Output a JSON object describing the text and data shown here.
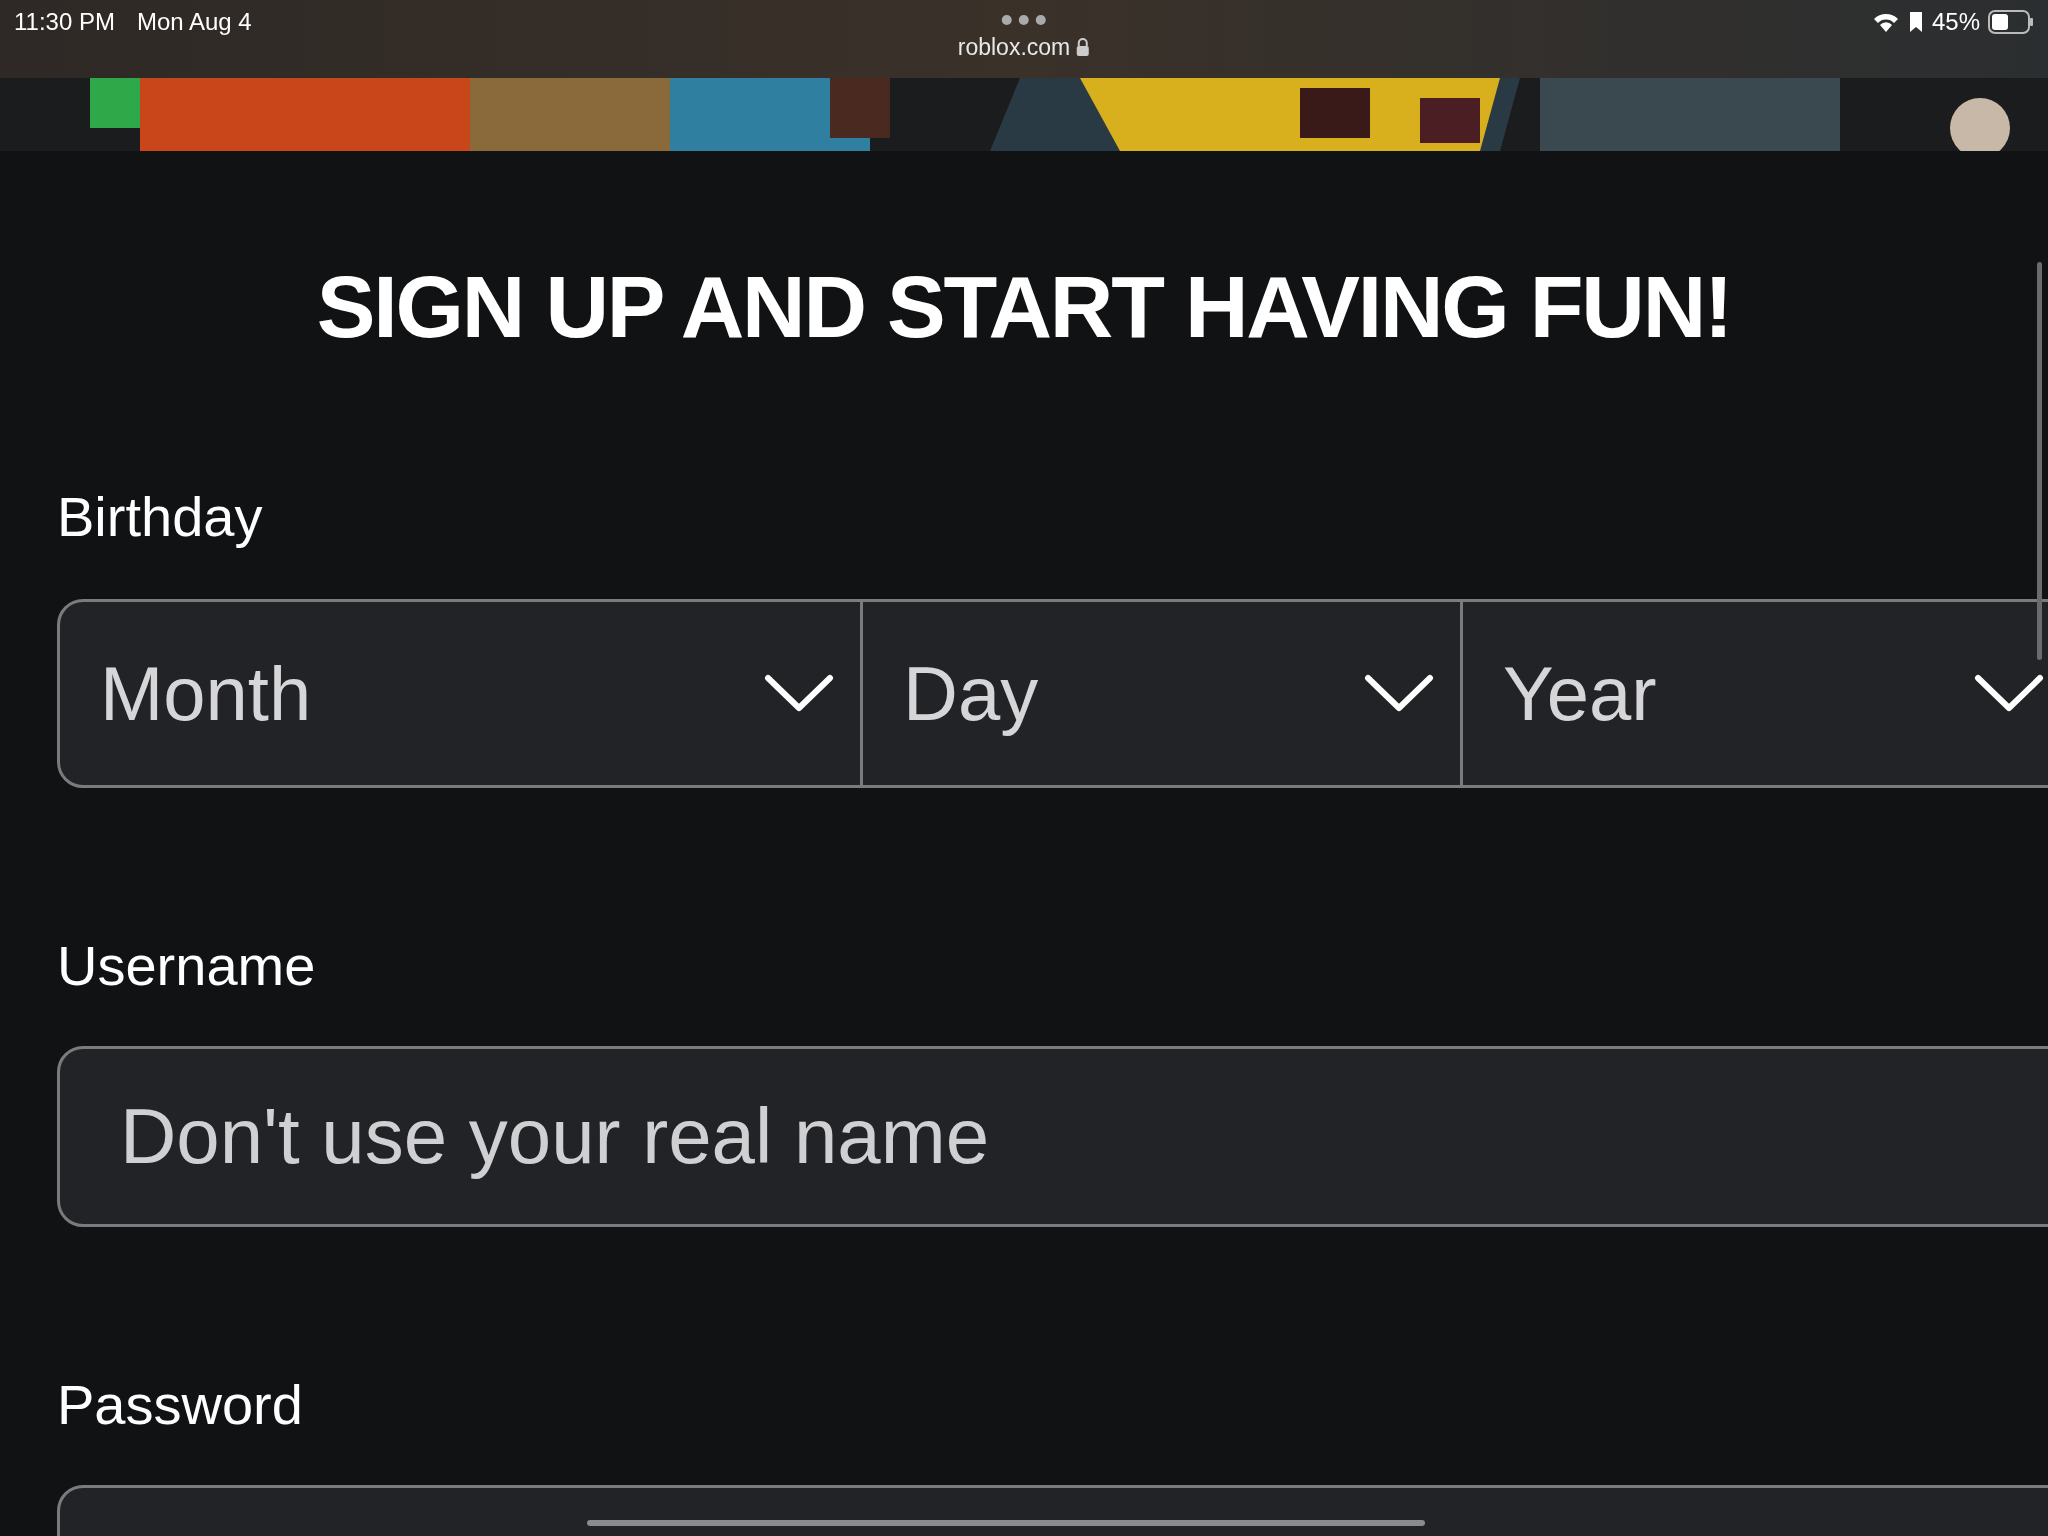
{
  "status_bar": {
    "time": "11:30 PM",
    "date": "Mon Aug 4",
    "url": "roblox.com",
    "battery": "45%"
  },
  "title": "SIGN UP AND START HAVING FUN!",
  "birthday": {
    "label": "Birthday",
    "selects": [
      {
        "label": "Month"
      },
      {
        "label": "Day"
      },
      {
        "label": "Year"
      }
    ]
  },
  "username": {
    "label": "Username",
    "placeholder": "Don't use your real name"
  },
  "password": {
    "label": "Password"
  }
}
